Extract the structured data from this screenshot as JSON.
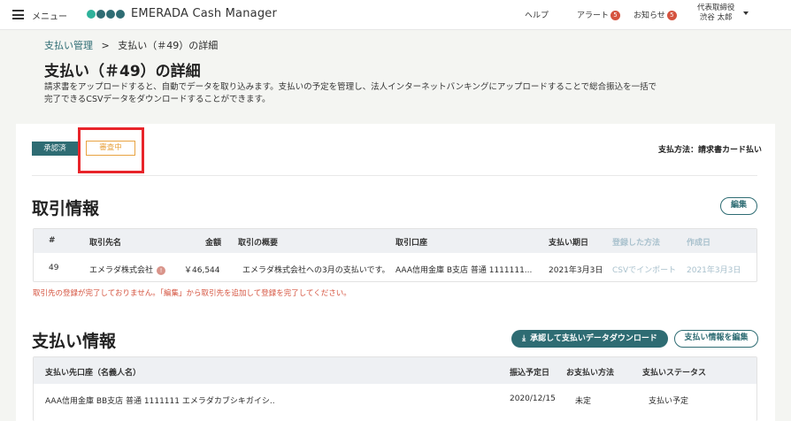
{
  "header": {
    "menu_label": "メニュー",
    "brand": "EMERADA Cash Manager",
    "logo_colors": [
      "#2eb29b",
      "#2e6c73",
      "#2e6c73",
      "#2e6c73"
    ],
    "help": "ヘルプ",
    "alert": "アラート",
    "alert_count": "5",
    "notice": "お知らせ",
    "notice_count": "5",
    "user_role": "代表取締役",
    "user_name": "渋谷 太郎"
  },
  "breadcrumb": {
    "parent": "支払い管理",
    "separator": ">",
    "current": "支払い（＃49）の詳細"
  },
  "page": {
    "title": "支払い（＃49）の詳細",
    "description": "請求書をアップロードすると、自動でデータを取り込みます。支払いの予定を管理し、法人インターネットバンキングにアップロードすることで総合振込を一括で完了できるCSVデータをダウンロードすることができます。"
  },
  "status": {
    "approved": "承認済",
    "review": "審査中",
    "pay_method_label": "支払方法：",
    "pay_method_value": "請求書カード払い"
  },
  "transaction": {
    "title": "取引情報",
    "edit_button": "編集",
    "headers": [
      "#",
      "取引先名",
      "金額",
      "取引の概要",
      "取引口座",
      "支払い期日",
      "登録した方法",
      "作成日"
    ],
    "row": {
      "id": "49",
      "partner": "エメラダ株式会社",
      "amount": "￥46,544",
      "summary": "エメラダ株式会社への3月の支払いです。",
      "account": "AAA信用金庫 B支店 普通 1111111...",
      "due_date": "2021年3月3日",
      "method": "CSVでインポート",
      "created": "2021年3月3日"
    },
    "error": "取引先の登録が完了しておりません。「編集」から取引先を追加して登録を完了してください。"
  },
  "payment": {
    "title": "支払い情報",
    "download_button": "承認して支払いデータダウンロード",
    "edit_button": "支払い情報を編集",
    "headers": [
      "支払い先口座（名義人名）",
      "振込予定日",
      "お支払い方法",
      "支払いステータス"
    ],
    "row": {
      "account": "AAA信用金庫 BB支店 普通 1111111 エメラダカブシキガイシ..",
      "date": "2020/12/15",
      "method": "未定",
      "status": "支払い予定"
    }
  },
  "colors": {
    "accent": "#2e6c73",
    "warning": "#e8a341",
    "error": "#d5533f",
    "highlight": "#e8242a"
  }
}
